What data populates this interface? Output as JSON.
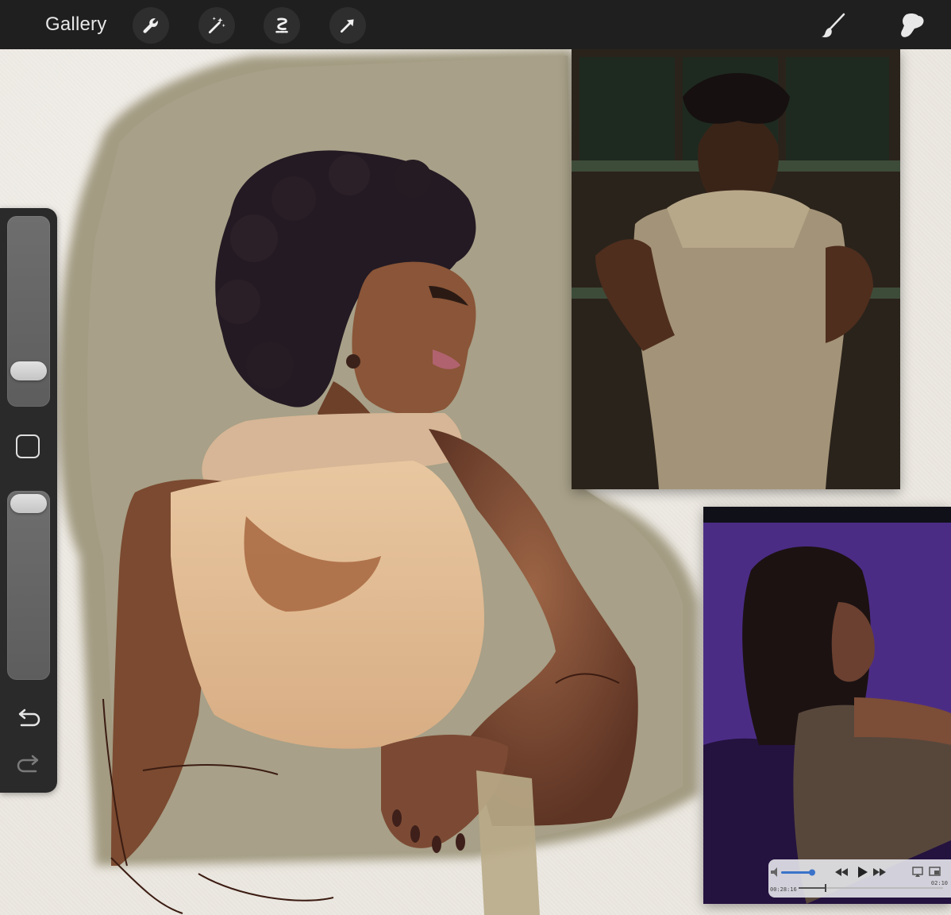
{
  "toolbar": {
    "gallery_label": "Gallery",
    "tools": [
      {
        "icon": "wrench-icon",
        "name": "actions"
      },
      {
        "icon": "magic-wand-icon",
        "name": "adjustments"
      },
      {
        "icon": "selection-icon",
        "name": "selection"
      },
      {
        "icon": "arrow-cursor-icon",
        "name": "transform"
      }
    ],
    "right_tools": [
      {
        "icon": "brush-icon",
        "name": "paint"
      },
      {
        "icon": "smudge-icon",
        "name": "smudge"
      }
    ]
  },
  "sidebar": {
    "brush_size_level": 0.78,
    "opacity_level": 0.05,
    "undo_icon": "undo-icon",
    "redo_icon": "redo-icon",
    "modify_icon": "square-modify-icon"
  },
  "video": {
    "time_elapsed": "00:28:16",
    "time_total": "02:10"
  },
  "colors": {
    "toolbar_bg": "#1f1f1f",
    "canvas_bg": "#ece8e1",
    "backdrop": "#a59d83",
    "video_bg": "#4a2a82"
  }
}
